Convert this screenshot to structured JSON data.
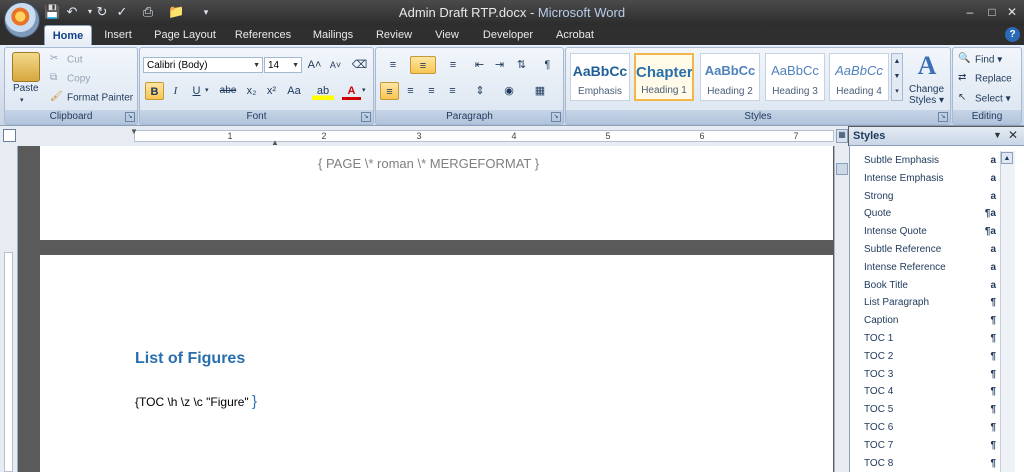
{
  "window": {
    "document_name": "Admin Draft RTP.docx",
    "separator": " - ",
    "app_name": "Microsoft Word",
    "minimize": "–",
    "maximize": "□",
    "close": "✕"
  },
  "qat": {
    "customize": "▾"
  },
  "tabs": [
    "Home",
    "Insert",
    "Page Layout",
    "References",
    "Mailings",
    "Review",
    "View",
    "Developer",
    "Acrobat"
  ],
  "help": "?",
  "clipboard": {
    "label": "Clipboard",
    "paste": "Paste",
    "cut": "Cut",
    "copy": "Copy",
    "format_painter": "Format Painter"
  },
  "font": {
    "label": "Font",
    "family": "Calibri (Body)",
    "size": "14",
    "grow": "A˄",
    "shrink": "A˅",
    "bold": "B",
    "italic": "I",
    "underline": "U",
    "strikethrough": "abe",
    "subscript": "x₂",
    "superscript": "x²",
    "change_case": "Aa",
    "highlight": "ab",
    "font_color": "A"
  },
  "paragraph": {
    "label": "Paragraph",
    "show_marks": "¶"
  },
  "styles_group": {
    "label": "Styles",
    "tiles": [
      {
        "sample": "AaBbCc",
        "name": "Emphasis"
      },
      {
        "sample": "Chapter",
        "name": "Heading 1"
      },
      {
        "sample": "AaBbCc",
        "name": "Heading 2"
      },
      {
        "sample": "AaBbCc",
        "name": "Heading 3"
      },
      {
        "sample": "AaBbCc",
        "name": "Heading 4"
      }
    ],
    "change_styles_line1": "Change",
    "change_styles_line2": "Styles ▾"
  },
  "editing": {
    "label": "Editing",
    "find": "Find ▾",
    "replace": "Replace",
    "select": "Select ▾"
  },
  "ruler": {
    "numbers": [
      "1",
      "2",
      "3",
      "4",
      "5",
      "6",
      "7"
    ]
  },
  "document": {
    "page_field": "{ PAGE  \\* roman  \\* MERGEFORMAT }",
    "heading": "List of Figures",
    "toc_open": "{",
    "toc_code": "TOC \\h \\z \\c \"Figure\" ",
    "toc_close": "}"
  },
  "styles_pane": {
    "title": "Styles",
    "items": [
      {
        "name": "Subtle Emphasis",
        "marker": "a"
      },
      {
        "name": "Intense Emphasis",
        "marker": "a"
      },
      {
        "name": "Strong",
        "marker": "a"
      },
      {
        "name": "Quote",
        "marker": "¶a"
      },
      {
        "name": "Intense Quote",
        "marker": "¶a"
      },
      {
        "name": "Subtle Reference",
        "marker": "a"
      },
      {
        "name": "Intense Reference",
        "marker": "a"
      },
      {
        "name": "Book Title",
        "marker": "a"
      },
      {
        "name": "List Paragraph",
        "marker": "¶"
      },
      {
        "name": "Caption",
        "marker": "¶"
      },
      {
        "name": "TOC 1",
        "marker": "¶"
      },
      {
        "name": "TOC 2",
        "marker": "¶"
      },
      {
        "name": "TOC 3",
        "marker": "¶"
      },
      {
        "name": "TOC 4",
        "marker": "¶"
      },
      {
        "name": "TOC 5",
        "marker": "¶"
      },
      {
        "name": "TOC 6",
        "marker": "¶"
      },
      {
        "name": "TOC 7",
        "marker": "¶"
      },
      {
        "name": "TOC 8",
        "marker": "¶"
      }
    ]
  }
}
